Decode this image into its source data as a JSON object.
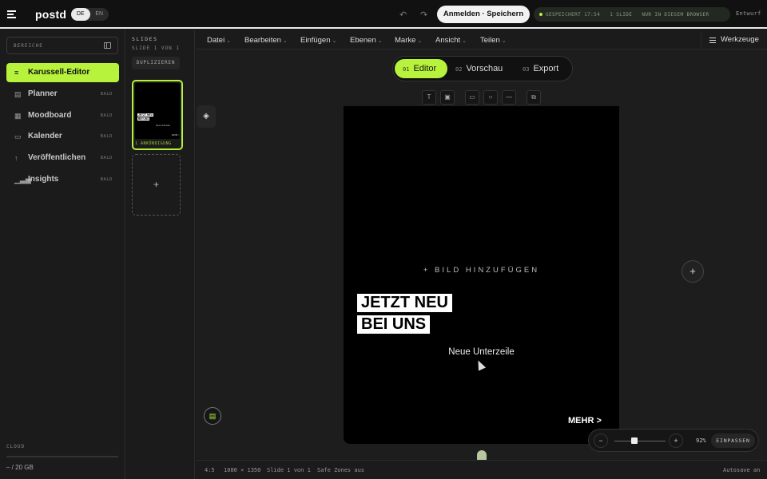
{
  "header": {
    "logo": "postd",
    "lang": [
      "DE",
      "EN"
    ],
    "login_label": "Anmelden · Speichern",
    "status": [
      "GESPEICHERT 17:54",
      "1 SLIDE",
      "NUR IN DIESEM BROWSER"
    ],
    "draft_label": "Entwurf"
  },
  "sidebar": {
    "areas_label": "BEREICHE",
    "items": [
      {
        "label": "Karussell-Editor",
        "badge": "",
        "icon": "list-icon"
      },
      {
        "label": "Planner",
        "badge": "BALD",
        "icon": "table-icon"
      },
      {
        "label": "Moodboard",
        "badge": "BALD",
        "icon": "grid-icon"
      },
      {
        "label": "Kalender",
        "badge": "BALD",
        "icon": "calendar-icon"
      },
      {
        "label": "Veröffentlichen",
        "badge": "BALD",
        "icon": "arrow-up-icon"
      },
      {
        "label": "Insights",
        "badge": "BALD",
        "icon": "bar-chart-icon"
      }
    ],
    "cloud_label": "CLOUD",
    "storage": "– / 20 GB"
  },
  "slides_panel": {
    "title": "SLIDES",
    "subtitle": "SLIDE 1 VON 1",
    "duplicate_label": "DUPLIZIEREN",
    "thumb_caption": "1  ANKÜNDIGUNG",
    "thumb_line1": "JETZT NEU",
    "thumb_line2": "BEI UNS",
    "thumb_sub": "Neue Unterzeile",
    "thumb_more": "MEHR >",
    "add_symbol": "+"
  },
  "menubar": {
    "items": [
      "Datei",
      "Bearbeiten",
      "Einfügen",
      "Ebenen",
      "Marke",
      "Ansicht",
      "Teilen"
    ],
    "tools_label": "Werkzeuge"
  },
  "modes": [
    {
      "num": "01",
      "label": "Editor"
    },
    {
      "num": "02",
      "label": "Vorschau"
    },
    {
      "num": "03",
      "label": "Export"
    }
  ],
  "canvas": {
    "add_image": "+ BILD HINZUFÜGEN",
    "headline1": "JETZT NEU",
    "headline2": "BEI UNS",
    "subline": "Neue Unterzeile",
    "more": "MEHR >"
  },
  "zoom": {
    "minus": "−",
    "plus": "+",
    "percent": "92%",
    "fit_label": "EINPASSEN",
    "level": 0.92
  },
  "footer": {
    "ratio": "4:5",
    "size": "1080 × 1350",
    "slide": "Slide 1 von 1",
    "safe": "Safe Zones aus",
    "autosave": "Autosave an"
  },
  "colors": {
    "accent": "#b7f23c",
    "bg": "#1b1b1b",
    "canvas": "#000000"
  }
}
